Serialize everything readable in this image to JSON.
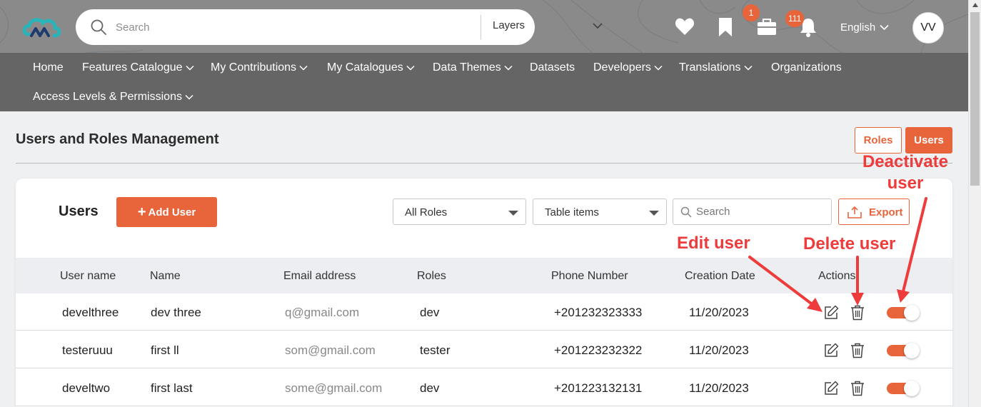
{
  "header": {
    "search_placeholder": "Search",
    "layer_select": "Layers",
    "briefcase_badge": "1",
    "bell_badge": "111",
    "language": "English",
    "avatar_initials": "VV"
  },
  "nav": {
    "items": [
      {
        "label": "Home"
      },
      {
        "label": "Features Catalogue"
      },
      {
        "label": "My Contributions"
      },
      {
        "label": "My Catalogues"
      },
      {
        "label": "Data Themes"
      },
      {
        "label": "Datasets"
      },
      {
        "label": "Developers"
      },
      {
        "label": "Translations"
      },
      {
        "label": "Organizations"
      },
      {
        "label": "Access Levels & Permissions"
      }
    ]
  },
  "page": {
    "title": "Users and Roles Management",
    "tab_roles": "Roles",
    "tab_users": "Users"
  },
  "card": {
    "title": "Users",
    "add_button": "Add User",
    "roles_filter": "All Roles",
    "table_items_filter": "Table items",
    "search_placeholder": "Search",
    "export_button": "Export"
  },
  "table": {
    "columns": [
      "User name",
      "Name",
      "Email address",
      "Roles",
      "Phone Number",
      "Creation Date",
      "Actions"
    ],
    "rows": [
      {
        "username": "develthree",
        "name": "dev three",
        "email": "q@gmail.com",
        "role": "dev",
        "phone": "+201232323333",
        "created": "11/20/2023",
        "active": true
      },
      {
        "username": "testeruuu",
        "name": "first ll",
        "email": "som@gmail.com",
        "role": "tester",
        "phone": "+201223232322",
        "created": "11/20/2023",
        "active": true
      },
      {
        "username": "develtwo",
        "name": "first last",
        "email": "some@gmail.com",
        "role": "dev",
        "phone": "+201223132131",
        "created": "11/20/2023",
        "active": true
      }
    ]
  },
  "annotations": {
    "deactivate": [
      "Deactivate",
      "user"
    ],
    "edit": "Edit user",
    "delete": "Delete user"
  },
  "colors": {
    "accent": "#e8643b",
    "annotation": "#ee3b3b",
    "nav_bg": "#656565",
    "header_bg": "#8a8a8a"
  }
}
